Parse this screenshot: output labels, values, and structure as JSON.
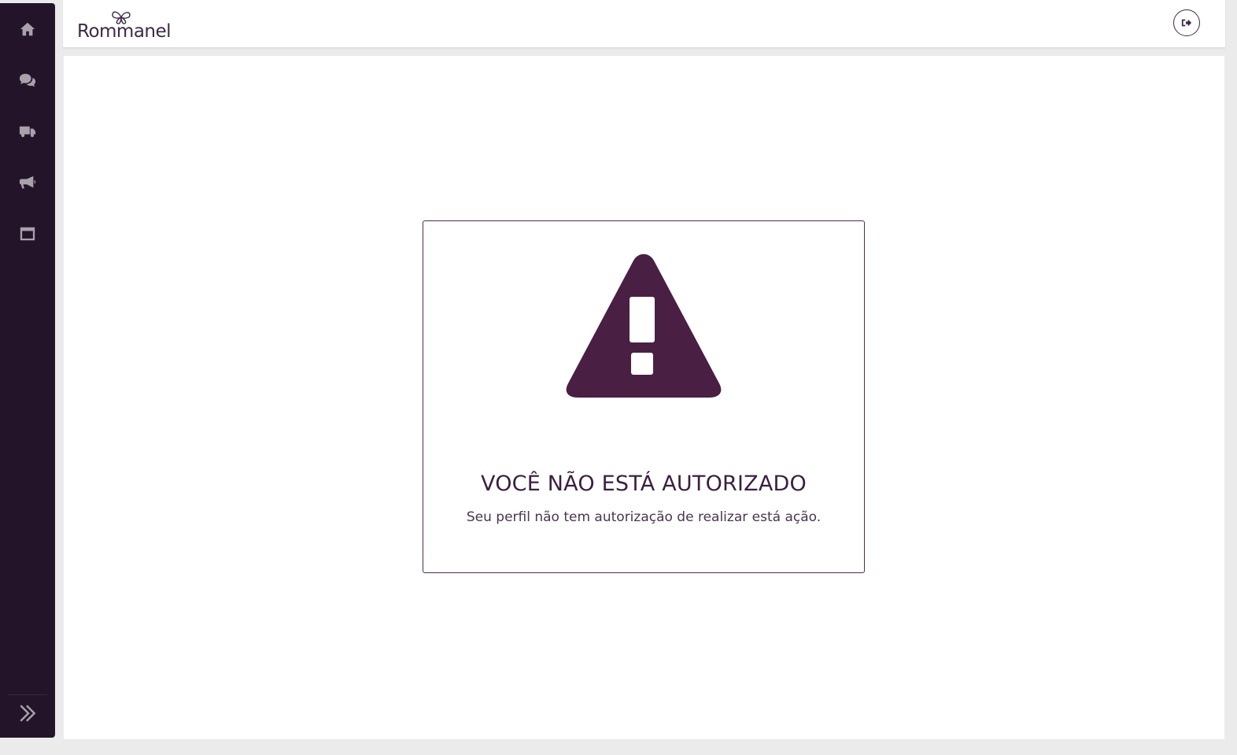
{
  "brand": {
    "name": "Rommanel",
    "accent_color": "#4a1f44",
    "sidebar_color": "#24142a"
  },
  "sidebar": {
    "items": [
      {
        "icon": "home-icon"
      },
      {
        "icon": "chat-icon"
      },
      {
        "icon": "truck-icon"
      },
      {
        "icon": "megaphone-icon"
      },
      {
        "icon": "window-icon"
      }
    ],
    "expand_icon": "double-chevron-right-icon"
  },
  "header": {
    "logout_icon": "logout-icon"
  },
  "alert": {
    "icon": "warning-triangle-icon",
    "title": "VOCÊ NÃO ESTÁ AUTORIZADO",
    "message": "Seu perfil não tem autorização de realizar está ação."
  }
}
